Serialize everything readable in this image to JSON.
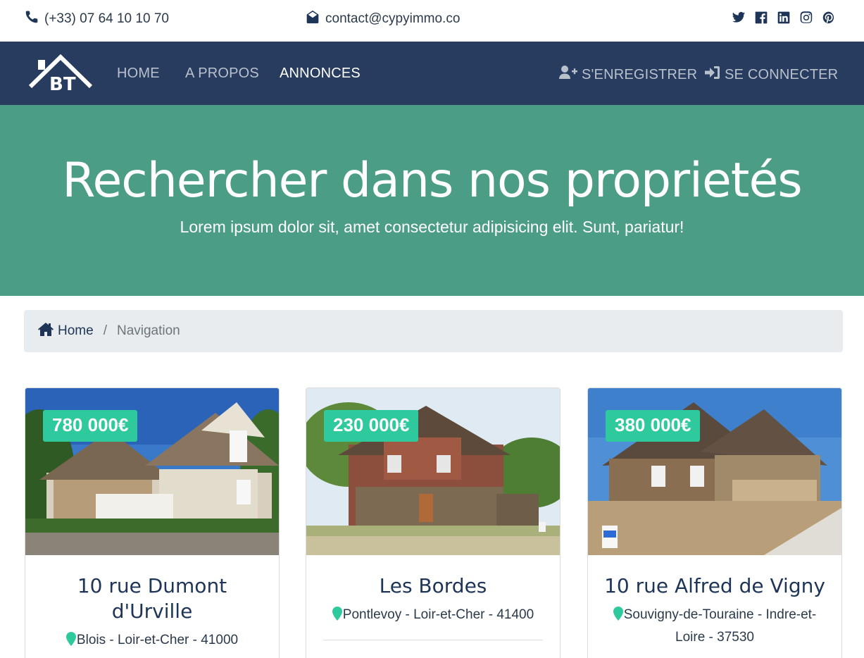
{
  "topbar": {
    "phone": "(+33) 07 64 10 10 70",
    "email": "contact@cypyimmo.co",
    "socials": [
      "twitter-icon",
      "facebook-icon",
      "linkedin-icon",
      "instagram-icon",
      "pinterest-icon"
    ]
  },
  "navbar": {
    "logo_text": "BT",
    "links": {
      "home": "HOME",
      "about": "A PROPOS",
      "listings": "ANNONCES",
      "register": "S'ENREGISTRER",
      "login": "SE CONNECTER"
    },
    "active": "ANNONCES"
  },
  "hero": {
    "title": "Rechercher dans nos proprietés",
    "subtitle": "Lorem ipsum dolor sit, amet consectetur adipisicing elit. Sunt, pariatur!"
  },
  "breadcrumb": {
    "home": "Home",
    "separator": "/",
    "current": "Navigation"
  },
  "listings": [
    {
      "price": "780 000€",
      "title": "10 rue Dumont d'Urville",
      "location": "Blois - Loir-et-Cher - 41000"
    },
    {
      "price": "230 000€",
      "title": "Les Bordes",
      "location": "Pontlevoy - Loir-et-Cher - 41400"
    },
    {
      "price": "380 000€",
      "title": "10 rue Alfred de Vigny",
      "location": "Souvigny-de-Touraine - Indre-et-Loire - 37530"
    }
  ],
  "colors": {
    "navbar": "#283c5f",
    "hero": "#4c9d86",
    "price_badge": "#2ec99d",
    "pin": "#2ec99d",
    "text_dark": "#1e3557"
  }
}
